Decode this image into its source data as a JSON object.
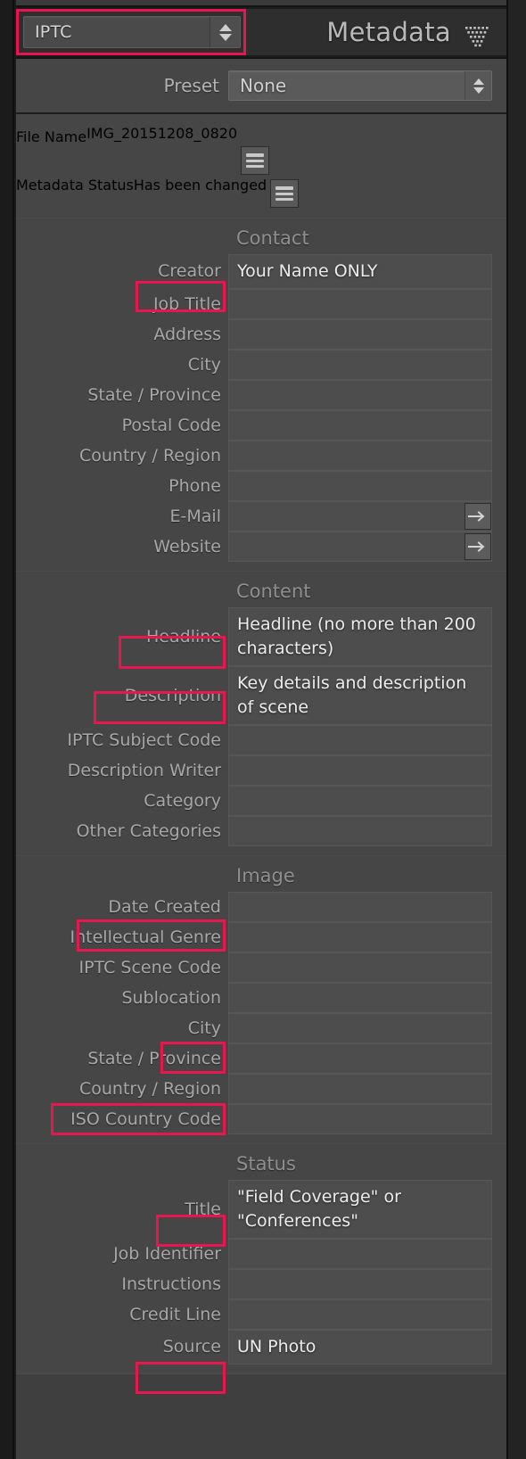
{
  "panel": {
    "title": "Metadata",
    "view_selector": {
      "value": "IPTC",
      "icon": "stepper-updown-icon"
    },
    "disclosure_icon": "dots-triangle-icon"
  },
  "preset": {
    "label": "Preset",
    "value": "None"
  },
  "file": {
    "rows": [
      {
        "label": "File Name",
        "value": "IMG_20151208_0820",
        "action_icon": "list-menu-icon"
      },
      {
        "label": "Metadata Status",
        "value": "Has been changed",
        "action_icon": "list-menu-icon"
      }
    ]
  },
  "sections": [
    {
      "title": "Contact",
      "rows": [
        {
          "label": "Creator",
          "value": "Your Name ONLY",
          "highlighted": true
        },
        {
          "label": "Job Title",
          "value": ""
        },
        {
          "label": "Address",
          "value": ""
        },
        {
          "label": "City",
          "value": ""
        },
        {
          "label": "State / Province",
          "value": ""
        },
        {
          "label": "Postal Code",
          "value": ""
        },
        {
          "label": "Country / Region",
          "value": ""
        },
        {
          "label": "Phone",
          "value": ""
        },
        {
          "label": "E-Mail",
          "value": "",
          "action_icon": "arrow-right-icon"
        },
        {
          "label": "Website",
          "value": "",
          "action_icon": "arrow-right-icon"
        }
      ]
    },
    {
      "title": "Content",
      "rows": [
        {
          "label": "Headline",
          "value": "Headline (no more than 200 characters)",
          "highlighted": true
        },
        {
          "label": "Description",
          "value": "Key details and description of scene",
          "highlighted": true
        },
        {
          "label": "IPTC Subject Code",
          "value": ""
        },
        {
          "label": "Description Writer",
          "value": ""
        },
        {
          "label": "Category",
          "value": ""
        },
        {
          "label": "Other Categories",
          "value": ""
        }
      ]
    },
    {
      "title": "Image",
      "rows": [
        {
          "label": "Date Created",
          "value": "",
          "highlighted": true
        },
        {
          "label": "Intellectual Genre",
          "value": ""
        },
        {
          "label": "IPTC Scene Code",
          "value": ""
        },
        {
          "label": "Sublocation",
          "value": ""
        },
        {
          "label": "City",
          "value": "",
          "highlighted": true
        },
        {
          "label": "State / Province",
          "value": ""
        },
        {
          "label": "Country / Region",
          "value": "",
          "highlighted": true
        },
        {
          "label": "ISO Country Code",
          "value": ""
        }
      ]
    },
    {
      "title": "Status",
      "rows": [
        {
          "label": "Title",
          "value": "\"Field Coverage\" or \"Conferences\"",
          "highlighted": true
        },
        {
          "label": "Job Identifier",
          "value": ""
        },
        {
          "label": "Instructions",
          "value": ""
        },
        {
          "label": "Credit Line",
          "value": ""
        },
        {
          "label": "Source",
          "value": "UN Photo",
          "highlighted": true
        }
      ]
    }
  ],
  "colors": {
    "annotation": "#e8164f",
    "panel_bg": "#464646",
    "field_bg": "#4d4d4d",
    "label_text": "#a8a8a8",
    "value_text": "#ececec"
  }
}
